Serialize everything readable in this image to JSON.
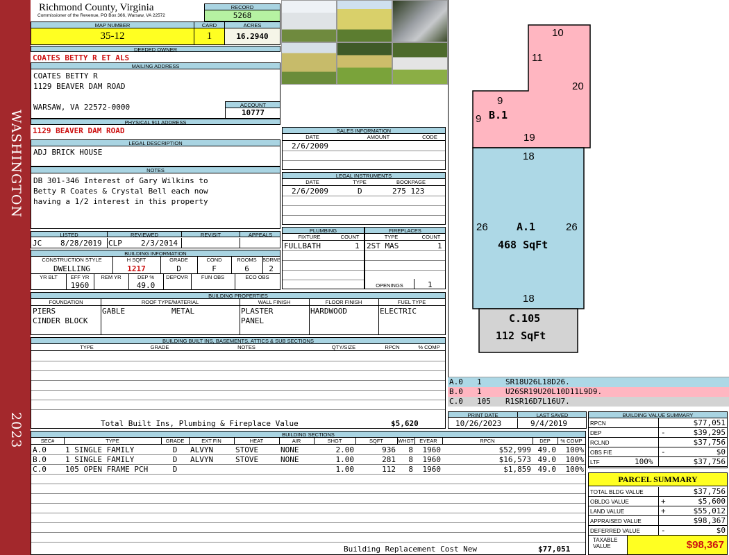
{
  "side": {
    "top": "WASHINGTON",
    "bottom": "2023"
  },
  "header": {
    "county": "Richmond County, Virginia",
    "office": "Commissioner of the Revenue, PO Box 366, Warsaw, VA 22572",
    "record_label": "RECORD",
    "record": "5268",
    "map_label": "MAP NUMBER",
    "map": "35-12",
    "card_label": "CARD",
    "card": "1",
    "acres_label": "ACRES",
    "acres": "16.2940"
  },
  "owner": {
    "label": "DEEDED OWNER",
    "name": "COATES BETTY R ET ALS"
  },
  "mailing": {
    "label": "MAILING ADDRESS",
    "line1": "COATES BETTY R",
    "line2": "1129 BEAVER DAM ROAD",
    "line3": "WARSAW, VA 22572-0000",
    "account_label": "ACCOUNT",
    "account": "10777"
  },
  "physical": {
    "label": "PHYSICAL 911 ADDRESS",
    "value": "1129 BEAVER DAM ROAD"
  },
  "legal": {
    "label": "LEGAL DESCRIPTION",
    "value": "ADJ BRICK HOUSE"
  },
  "notes": {
    "label": "NOTES",
    "line1": "DB 301-346 Interest of Gary Wilkins to",
    "line2": "Betty R Coates & Crystal Bell each now",
    "line3": "having a 1/2 interest in this property"
  },
  "status": {
    "listed_label": "LISTED",
    "listed_by": "JC",
    "listed_date": "8/28/2019",
    "reviewed_label": "REVIEWED",
    "reviewed_by": "CLP",
    "reviewed_date": "2/3/2014",
    "revisit_label": "REVISIT",
    "appeals_label": "APPEALS"
  },
  "building_info": {
    "label": "BUILDING INFORMATION",
    "h": [
      "CONSTRUCTION STYLE",
      "H SQFT",
      "GRADE",
      "COND",
      "ROOMS",
      "BDRMS"
    ],
    "v": [
      "DWELLING",
      "1217",
      "D",
      "F",
      "6",
      "2"
    ],
    "h2": [
      "YR BLT",
      "EFF YR",
      "REM YR",
      "DEP %",
      "DEPOVR",
      "FUN OBS",
      "ECO OBS"
    ],
    "v2": [
      "",
      "1960",
      "",
      "49.0",
      "",
      "",
      ""
    ]
  },
  "props": {
    "label": "BUILDING PROPERTIES",
    "h": [
      "FOUNDATION",
      "ROOF TYPE/MATERIAL",
      "WALL FINISH",
      "FLOOR FINISH",
      "FUEL TYPE"
    ],
    "foundation1": "PIERS",
    "foundation2": "CINDER BLOCK",
    "roof1": "GABLE",
    "roof2": "METAL",
    "wall1": "PLASTER",
    "wall2": "PANEL",
    "floor": "HARDWOOD",
    "fuel": "ELECTRIC"
  },
  "builtins": {
    "label": "BUILDING BUILT INS, BASEMENTS, ATTICS & SUB SECTIONS",
    "h": [
      "TYPE",
      "GRADE",
      "NOTES",
      "QTY/SIZE",
      "RPCN",
      "% COMP"
    ],
    "total_label": "Total Built Ins, Plumbing & Fireplace Value",
    "total": "$5,620"
  },
  "sales": {
    "label": "SALES INFORMATION",
    "h": [
      "DATE",
      "AMOUNT",
      "CODE"
    ],
    "date": "2/6/2009"
  },
  "legal_inst": {
    "label": "LEGAL INSTRUMENTS",
    "h": [
      "DATE",
      "TYPE",
      "BOOKPAGE"
    ],
    "date": "2/6/2009",
    "type": "D",
    "bookpage": "275 123"
  },
  "plumbing": {
    "label": "PLUMBING",
    "h": [
      "FIXTURE",
      "COUNT"
    ],
    "fixture": "FULLBATH",
    "count": "1"
  },
  "fireplaces": {
    "label": "FIREPLACES",
    "h": [
      "TYPE",
      "COUNT"
    ],
    "type": "2ST MAS",
    "count": "1",
    "openings_label": "OPENINGS",
    "openings": "1"
  },
  "sketch": {
    "b_label": "B.1",
    "a_label": "A.1",
    "a_area": "468 SqFt",
    "c_label": "C.105",
    "c_area": "112 SqFt",
    "d10": "10",
    "d11": "11",
    "d20": "20",
    "d9a": "9",
    "d9b": "9",
    "d19": "19",
    "d18a": "18",
    "d26a": "26",
    "d26b": "26",
    "d18b": "18"
  },
  "vectors": [
    {
      "sec": "A.0",
      "n": "1",
      "code": "SR18U26L18D26.",
      "color": "#add8e6"
    },
    {
      "sec": "B.0",
      "n": "1",
      "code": "U26SR19U20L10D11L9D9.",
      "color": "#ffb6c1"
    },
    {
      "sec": "C.0",
      "n": "105",
      "code": "R1SR16D7L16U7.",
      "color": "#d3d3d3"
    }
  ],
  "print": {
    "print_label": "PRINT DATE",
    "print_date": "10/26/2023",
    "saved_label": "LAST SAVED",
    "saved_date": "9/4/2019"
  },
  "sections": {
    "label": "BUILDING SECTIONS",
    "h": [
      "SEC#",
      "TYPE",
      "GRADE",
      "EXT FIN",
      "HEAT",
      "AIR",
      "SHGT",
      "SQFT",
      "WHGT",
      "EYEAR",
      "RPCN",
      "DEP",
      "% COMP"
    ],
    "rows": [
      [
        "A.0",
        "1 SINGLE FAMILY",
        "D",
        "ALVYN",
        "STOVE",
        "NONE",
        "2.00",
        "936",
        "8",
        "1960",
        "$52,999",
        "49.0",
        "100%"
      ],
      [
        "B.0",
        "1 SINGLE FAMILY",
        "D",
        "ALVYN",
        "STOVE",
        "NONE",
        "1.00",
        "281",
        "8",
        "1960",
        "$16,573",
        "49.0",
        "100%"
      ],
      [
        "C.0",
        "105 OPEN FRAME PCH",
        "D",
        "",
        "",
        "",
        "1.00",
        "112",
        "8",
        "1960",
        "$1,859",
        "49.0",
        "100%"
      ]
    ],
    "total_label": "Building Replacement Cost New",
    "total": "$77,051"
  },
  "bvs": {
    "label": "BUILDING VALUE SUMMARY",
    "rpcn_l": "RPCN",
    "rpcn": "$77,051",
    "dep_l": "DEP",
    "dep_s": "-",
    "dep": "$39,295",
    "rclnd_l": "RCLND",
    "rclnd": "$37,756",
    "obs_l": "OBS F/E",
    "obs_s": "-",
    "obs": "$0",
    "ltr_l": "LTF",
    "ltr_p": "100%",
    "ltr": "$37,756"
  },
  "parcel": {
    "label": "PARCEL SUMMARY",
    "tbv_l": "TOTAL BLDG VALUE",
    "tbv": "$37,756",
    "obv_l": "OBLDG VALUE",
    "obv_s": "+",
    "obv": "$5,600",
    "land_l": "LAND VALUE",
    "land_s": "+",
    "land": "$55,012",
    "app_l": "APPRAISED VALUE",
    "app": "$98,367",
    "def_l": "DEFERRED VALUE",
    "def_s": "-",
    "def": "$0",
    "tax_l1": "TAXABLE",
    "tax_l2": "VALUE",
    "tax": "$98,367"
  },
  "photos": [
    "house-photo-1",
    "house-photo-2",
    "mailbox-photo",
    "house-photo-3",
    "house-photo-4",
    "mobile-home-photo"
  ]
}
